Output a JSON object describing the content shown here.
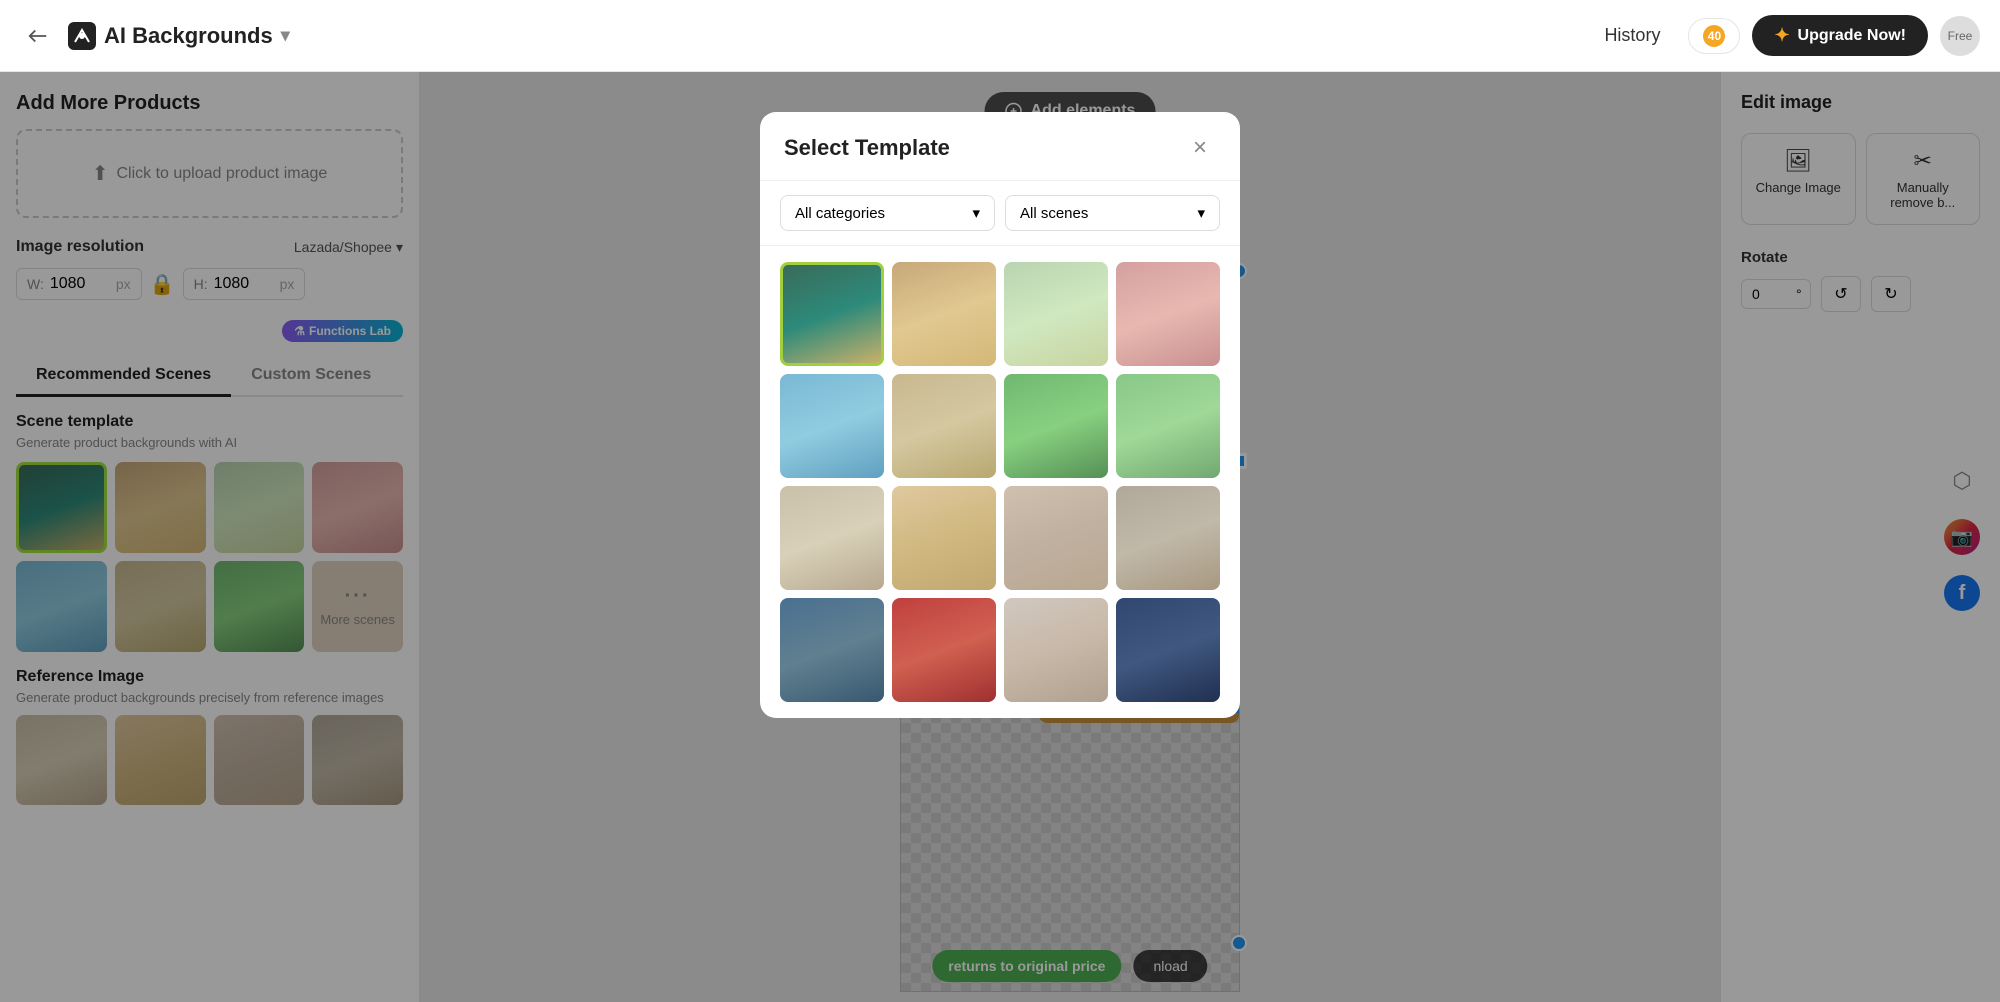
{
  "header": {
    "back_label": "←",
    "app_name": "AI Backgrounds",
    "dropdown_icon": "▾",
    "history_label": "History",
    "credits_count": "40",
    "upgrade_label": "Upgrade Now!",
    "avatar_label": "Free"
  },
  "left_panel": {
    "section_title": "Add More Products",
    "upload_label": "Click to upload product image",
    "image_res_label": "Image resolution",
    "preset_label": "Lazada/Shopee",
    "width_label": "W:",
    "width_value": "1080",
    "height_label": "H:",
    "height_value": "1080",
    "px_label": "px",
    "functions_badge": "Functions Lab",
    "tab_recommended": "Recommended Scenes",
    "tab_custom": "Custom Scenes",
    "scene_template_title": "Scene template",
    "scene_template_desc": "Generate product backgrounds with AI",
    "more_scenes_label": "More scenes",
    "reference_title": "Reference Image",
    "reference_desc": "Generate product backgrounds precisely from reference images"
  },
  "modal": {
    "title": "Select Template",
    "close_label": "×",
    "filter_categories": "All categories",
    "filter_scenes": "All scenes",
    "chevron": "▾"
  },
  "right_panel": {
    "edit_title": "Edit image",
    "change_image_label": "Change Image",
    "manually_remove_label": "Manually remove b...",
    "rotate_label": "Rotate",
    "rotate_value": "0",
    "degree_symbol": "°"
  },
  "canvas": {
    "add_elements_label": "Add elements",
    "returns_label": "returns to original price",
    "download_label": "nload"
  },
  "social": {
    "share_icon": "share",
    "instagram_icon": "ig",
    "facebook_icon": "f"
  },
  "scene_thumbnails": [
    {
      "id": 1,
      "color_class": "c1",
      "selected": true
    },
    {
      "id": 2,
      "color_class": "c2",
      "selected": false
    },
    {
      "id": 3,
      "color_class": "c3",
      "selected": false
    },
    {
      "id": 4,
      "color_class": "c4",
      "selected": false
    },
    {
      "id": 5,
      "color_class": "c5",
      "selected": false
    },
    {
      "id": 6,
      "color_class": "c6",
      "selected": false
    },
    {
      "id": 7,
      "color_class": "c7",
      "selected": false
    }
  ],
  "modal_thumbnails": [
    {
      "id": 1,
      "color_class": "c1",
      "selected": true
    },
    {
      "id": 2,
      "color_class": "c2",
      "selected": false
    },
    {
      "id": 3,
      "color_class": "c3",
      "selected": false
    },
    {
      "id": 4,
      "color_class": "c4",
      "selected": false
    },
    {
      "id": 5,
      "color_class": "c5",
      "selected": false
    },
    {
      "id": 6,
      "color_class": "c6",
      "selected": false
    },
    {
      "id": 7,
      "color_class": "c7",
      "selected": false
    },
    {
      "id": 8,
      "color_class": "c8",
      "selected": false
    },
    {
      "id": 9,
      "color_class": "c9",
      "selected": false
    },
    {
      "id": 10,
      "color_class": "c10",
      "selected": false
    },
    {
      "id": 11,
      "color_class": "c11",
      "selected": false
    },
    {
      "id": 12,
      "color_class": "c12",
      "selected": false
    },
    {
      "id": 13,
      "color_class": "c13",
      "selected": false
    },
    {
      "id": 14,
      "color_class": "c14",
      "selected": false
    },
    {
      "id": 15,
      "color_class": "c15",
      "selected": false
    },
    {
      "id": 16,
      "color_class": "c16",
      "selected": false
    }
  ]
}
